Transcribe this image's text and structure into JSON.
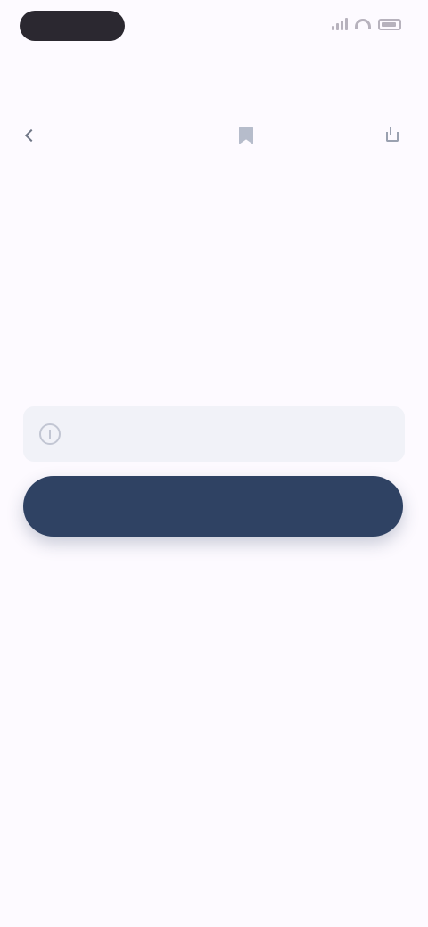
{
  "status_bar": {
    "time": "",
    "icons": [
      "signal-icon",
      "wifi-icon",
      "battery-icon"
    ]
  },
  "header": {
    "title": ""
  },
  "subnav": {
    "back_label": "",
    "save_label": "",
    "share_label": ""
  },
  "article": {
    "headline": "",
    "body": ""
  },
  "info_card": {
    "icon": "info-icon",
    "text": ""
  },
  "cta": {
    "label": ""
  },
  "colors": {
    "background": "#fdfaff",
    "time_pill": "#2b2830",
    "cta_background": "#2f4263",
    "card_background": "#f1f2f8"
  }
}
